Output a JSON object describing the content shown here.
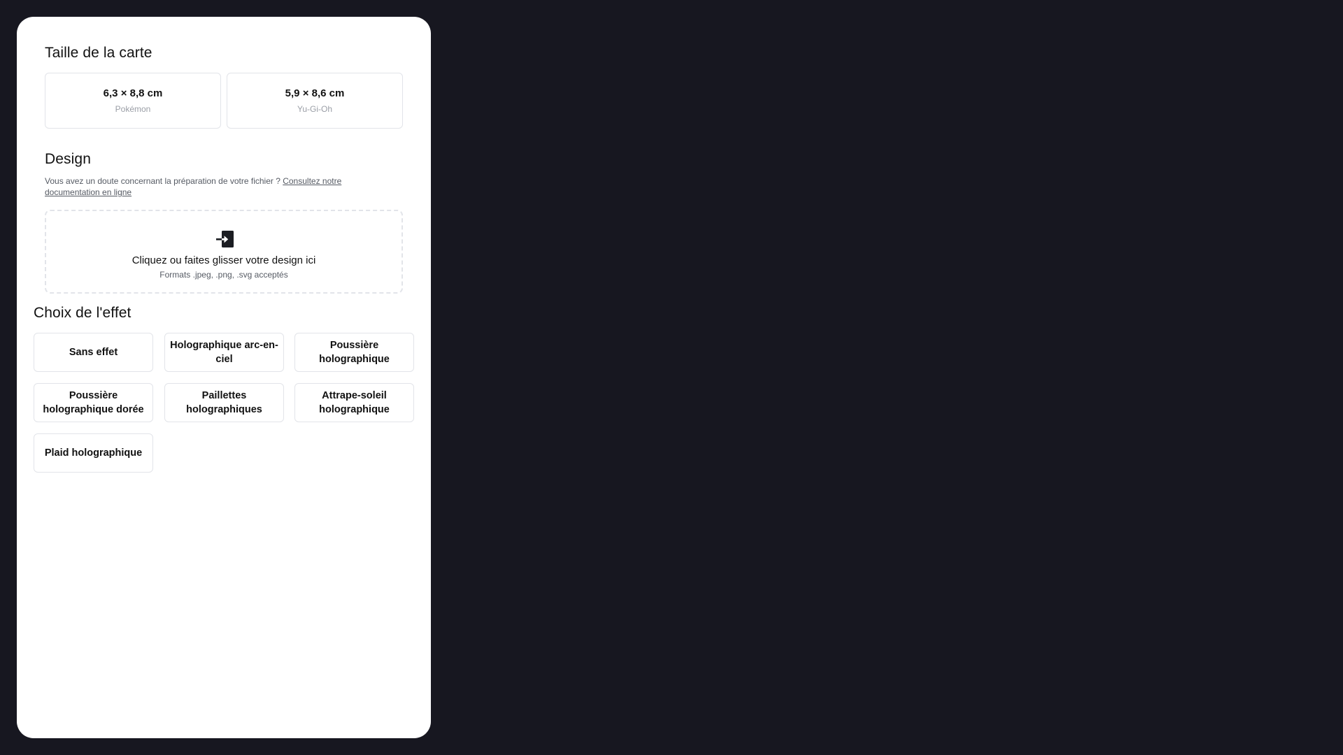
{
  "card_size": {
    "title": "Taille de la carte",
    "options": [
      {
        "dimensions": "6,3 × 8,8 cm",
        "brand": "Pokémon"
      },
      {
        "dimensions": "5,9 × 8,6 cm",
        "brand": "Yu-Gi-Oh"
      }
    ]
  },
  "design": {
    "title": "Design",
    "hint_text": "Vous avez un doute concernant la préparation de votre fichier ? ",
    "hint_link": "Consultez notre documentation en ligne",
    "dropzone": {
      "icon": "upload-icon",
      "main_text": "Cliquez ou faites glisser votre design ici",
      "sub_text": "Formats .jpeg, .png, .svg acceptés"
    }
  },
  "effects": {
    "title": "Choix de l'effet",
    "options": [
      "Sans effet",
      "Holographique arc-en-ciel",
      "Poussière holographique",
      "Poussière holographique dorée",
      "Paillettes holographiques",
      "Attrape-soleil holographique",
      "Plaid holographique"
    ]
  },
  "colors": {
    "background": "#171720",
    "panel": "#ffffff",
    "border": "#e2e4e9",
    "muted_text": "#9a9ea6"
  }
}
